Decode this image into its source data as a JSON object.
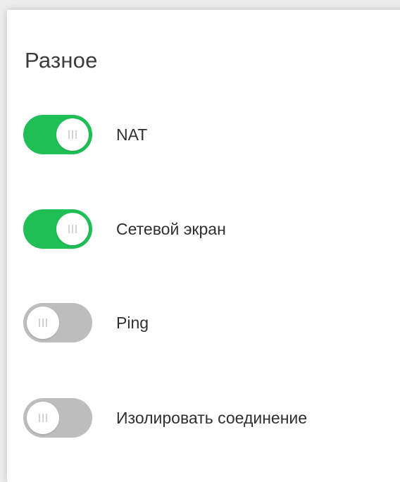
{
  "section": {
    "title": "Разное"
  },
  "toggles": [
    {
      "label": "NAT",
      "state": "on"
    },
    {
      "label": "Сетевой экран",
      "state": "on"
    },
    {
      "label": "Ping",
      "state": "off"
    },
    {
      "label": "Изолировать соединение",
      "state": "off"
    }
  ],
  "colors": {
    "on": "#1fbf55",
    "off": "#bdbdbd",
    "knob": "#ffffff"
  }
}
